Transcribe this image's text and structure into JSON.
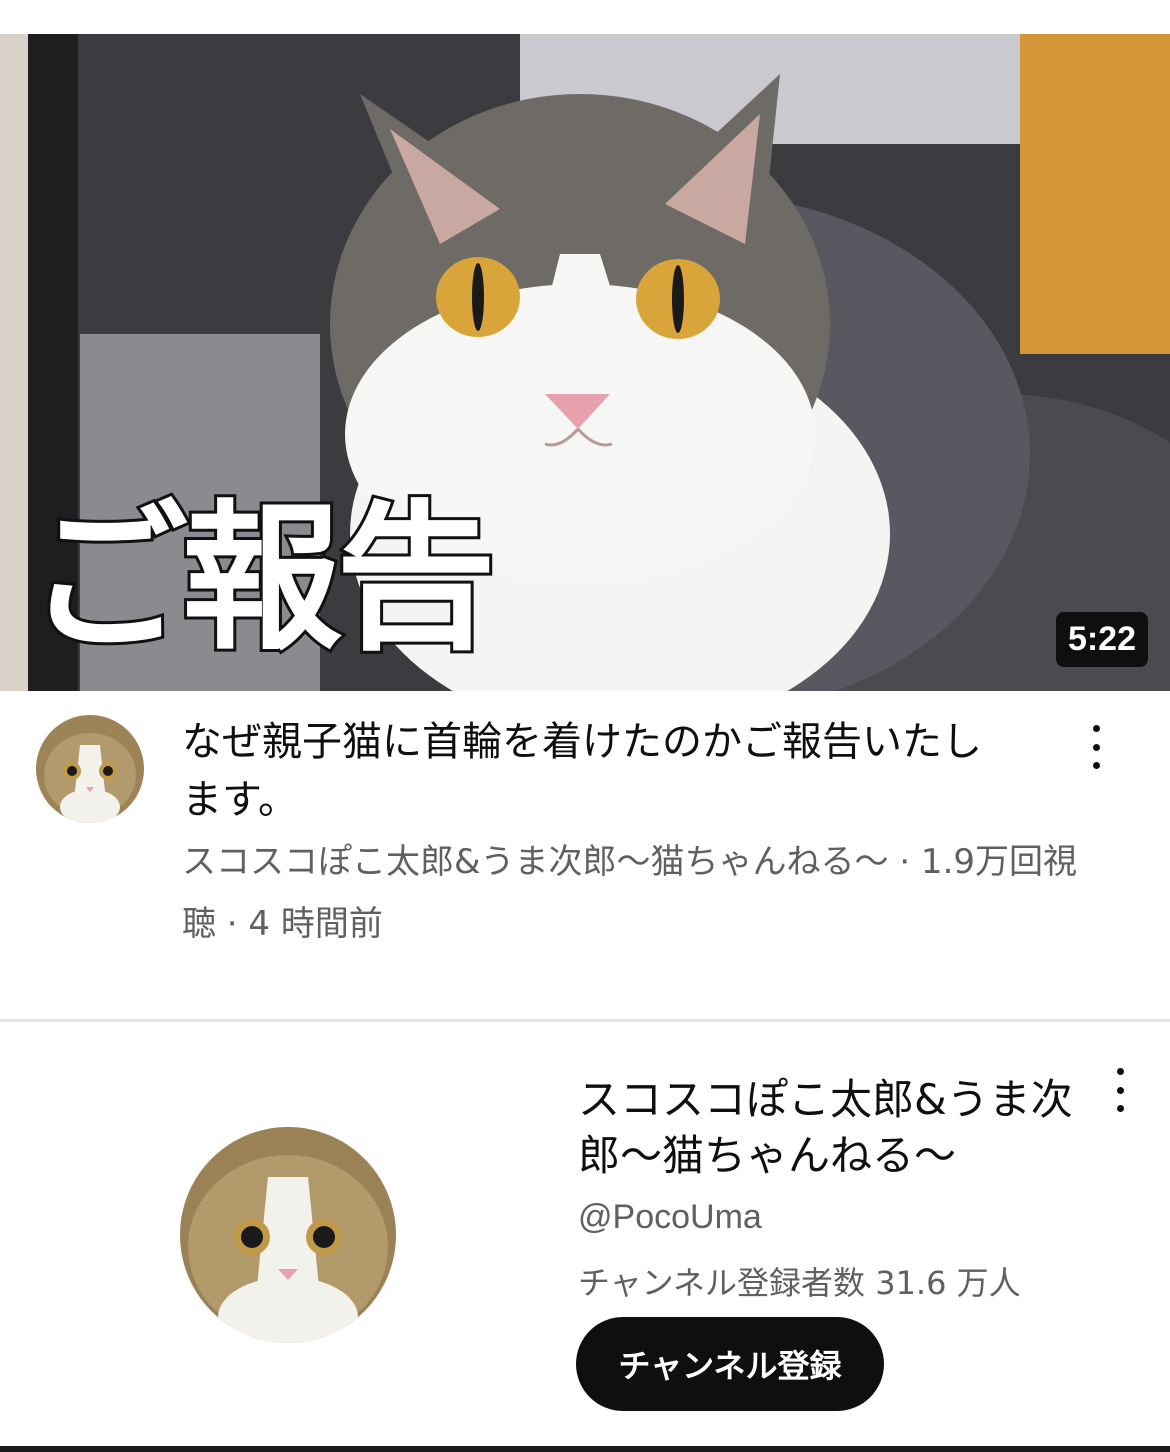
{
  "video": {
    "thumbnail_overlay_text": "ご報告",
    "duration": "5:22",
    "title": "なぜ親子猫に首輪を着けたのかご報告いたします。",
    "channel_and_views": "スコスコぽこ太郎&うま次郎〜猫ちゃんねる〜 · 1.9万回視聴 · 4 時間前"
  },
  "channel": {
    "name": "スコスコぽこ太郎&うま次郎〜猫ちゃんねる〜",
    "handle": "@PocoUma",
    "subscribers": "チャンネル登録者数 31.6 万人",
    "subscribe_label": "チャンネル登録"
  },
  "icons": {
    "video_menu": "more-vert-icon",
    "channel_menu": "more-vert-icon"
  },
  "colors": {
    "subscribe_bg": "#0f0f0f",
    "secondary_text": "#606060"
  }
}
